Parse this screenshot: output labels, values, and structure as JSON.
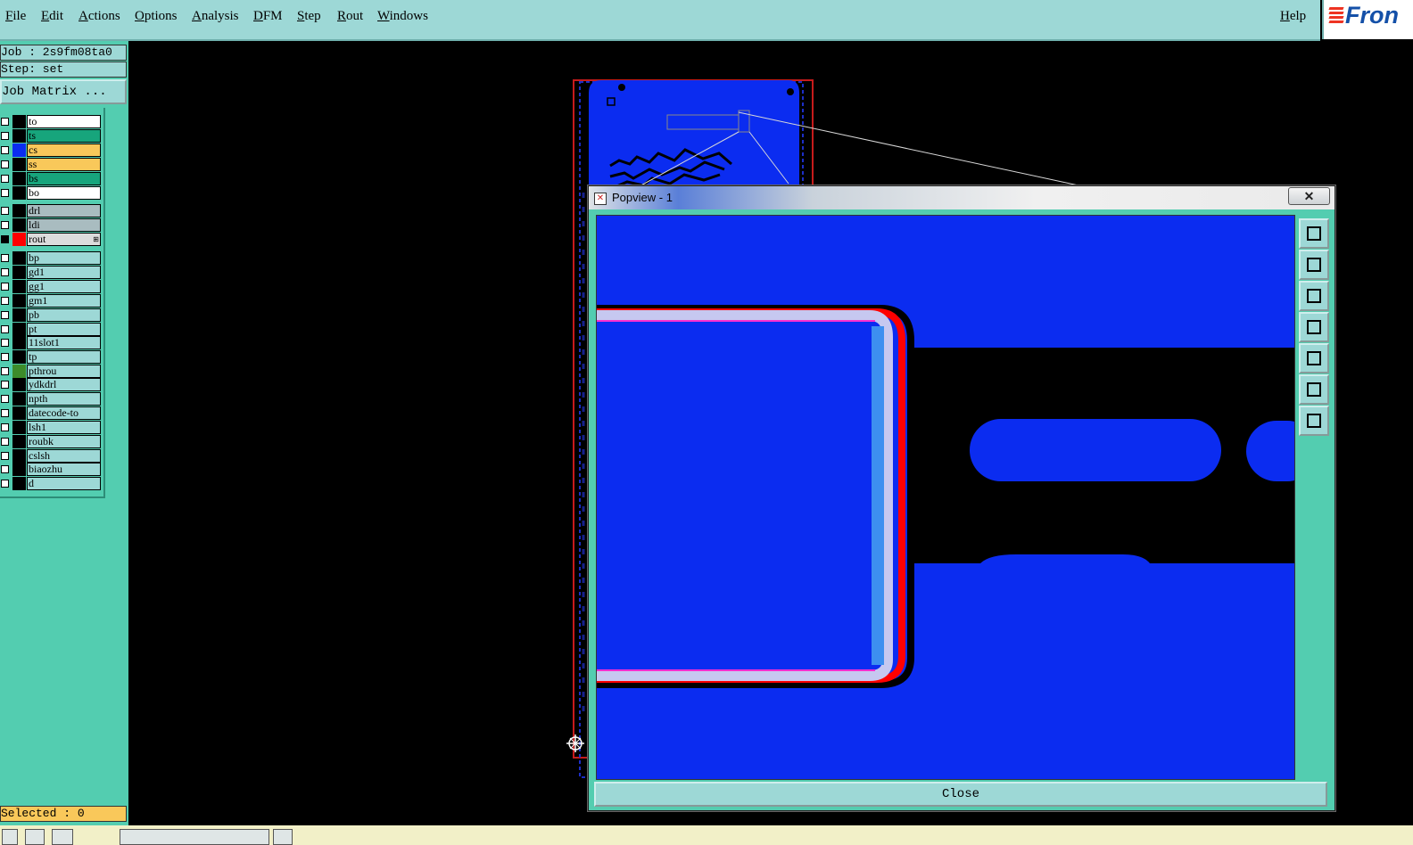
{
  "menubar": {
    "items": [
      "File",
      "Edit",
      "Actions",
      "Options",
      "Analysis",
      "DFM",
      "Step",
      "Rout",
      "Windows"
    ],
    "help": "Help"
  },
  "logo": {
    "text": "Fron"
  },
  "left_panel": {
    "job": "Job : 2s9fm08ta0",
    "step": "Step: set",
    "job_matrix": "Job Matrix ...",
    "selected": "Selected : 0",
    "layers": [
      {
        "name": "to",
        "bg": "#ffffff",
        "swatch": "#000000"
      },
      {
        "name": "ts",
        "bg": "#17a57c",
        "swatch": "#000000"
      },
      {
        "name": "cs",
        "bg": "#f9c85a",
        "swatch": "#0b2cf0"
      },
      {
        "name": "ss",
        "bg": "#f9c85a",
        "swatch": "#000000"
      },
      {
        "name": "bs",
        "bg": "#17a57c",
        "swatch": "#000000"
      },
      {
        "name": "bo",
        "bg": "#ffffff",
        "swatch": "#000000"
      },
      {
        "name": "drl",
        "bg": "#a9bcc0",
        "swatch": "#000000"
      },
      {
        "name": "ldi",
        "bg": "#a9bcc0",
        "swatch": "#000000"
      },
      {
        "name": "rout",
        "bg": "#dcdcdc",
        "swatch": "#ff0000",
        "active": true
      },
      {
        "name": "bp",
        "bg": "#9dd8d6",
        "swatch": "#000000"
      },
      {
        "name": "gd1",
        "bg": "#9dd8d6",
        "swatch": "#000000"
      },
      {
        "name": "gg1",
        "bg": "#9dd8d6",
        "swatch": "#000000"
      },
      {
        "name": "gm1",
        "bg": "#9dd8d6",
        "swatch": "#000000"
      },
      {
        "name": "pb",
        "bg": "#9dd8d6",
        "swatch": "#000000"
      },
      {
        "name": "pt",
        "bg": "#9dd8d6",
        "swatch": "#000000"
      },
      {
        "name": "11slot1",
        "bg": "#9dd8d6",
        "swatch": "#000000"
      },
      {
        "name": "tp",
        "bg": "#9dd8d6",
        "swatch": "#000000"
      },
      {
        "name": "pthrou",
        "bg": "#9dd8d6",
        "swatch": "#3d8c2a"
      },
      {
        "name": "ydkdrl",
        "bg": "#9dd8d6",
        "swatch": "#000000"
      },
      {
        "name": "npth",
        "bg": "#9dd8d6",
        "swatch": "#000000"
      },
      {
        "name": "datecode-to",
        "bg": "#9dd8d6",
        "swatch": "#000000"
      },
      {
        "name": "lsh1",
        "bg": "#9dd8d6",
        "swatch": "#000000"
      },
      {
        "name": "roubk",
        "bg": "#9dd8d6",
        "swatch": "#000000"
      },
      {
        "name": "cslsh",
        "bg": "#9dd8d6",
        "swatch": "#000000"
      },
      {
        "name": "biaozhu",
        "bg": "#9dd8d6",
        "swatch": "#000000"
      },
      {
        "name": "d",
        "bg": "#9dd8d6",
        "swatch": "#000000"
      }
    ]
  },
  "popview": {
    "title": "Popview - 1",
    "close_x": "✕",
    "close_label": "Close",
    "side_buttons": [
      "zoom-window-icon",
      "pan-up-icon",
      "pan-down-icon",
      "pan-left-icon",
      "pan-right-icon",
      "zoom-out-icon",
      "zoom-in-icon"
    ]
  },
  "bottombar": {
    "command": ""
  },
  "colors": {
    "copper": "#0b2cf0",
    "rout": "#ff0000",
    "panel": "#53cdb0",
    "menu": "#9dd8d6",
    "selected": "#f9c85a"
  }
}
